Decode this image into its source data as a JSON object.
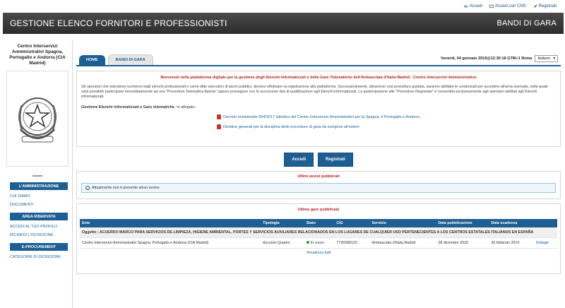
{
  "topbar": {
    "links": [
      {
        "label": "Accedi",
        "icon": "key-icon"
      },
      {
        "label": "Accedi con CNS",
        "icon": "card-icon"
      },
      {
        "label": "Registrati",
        "icon": "pencil-icon"
      }
    ]
  },
  "header": {
    "title": "GESTIONE ELENCO FORNITORI E PROFESSIONISTI",
    "right": "BANDI DI GARA"
  },
  "sidebar": {
    "org_name": "Centro Interservizi Amministrativi Spagna, Portogallo e Andorra (CIA Madrid)",
    "sections": [
      {
        "heading": "L'AMMINISTRAZIONE",
        "items": [
          "CHI SIAMO",
          "DOCUMENTI"
        ]
      },
      {
        "heading": "AREA RISERVATA",
        "items": [
          "ACCEDI AL TUO PROFILO",
          "RICHIEDI L'ISCRIZIONE"
        ]
      },
      {
        "heading": "E-PROCUREMENT",
        "items": [
          "CATEGORIE DI ISCRIZIONE"
        ]
      }
    ]
  },
  "tabs": [
    {
      "label": "HOME",
      "active": true
    },
    {
      "label": "BANDI DI GARA",
      "active": false
    }
  ],
  "datetime": "Venerdì, 04 gennaio 2019@12:30:18 GTM+1 Roma",
  "language": {
    "selected": "Italiano"
  },
  "welcome": {
    "title": "Benvenuti nella piattaforma digitale per la gestione degli Elenchi Informatizzati e delle Gare Telematiche dell'Ambasciata d'Italia Madrid - Centro Interservizi Amministrativo",
    "text": "Gli operatori che intendono iscriversi negli elenchi professionali o come ditte esecutrici di lavori pubblici, devono effettuare la registrazione alla piattaforma. Successivamente, attraverso una procedura guidata, saranno abilitate le credenziali per accedere all'area riservata, nella quale sarà possibile partecipare immediatamente ad una \"Procedura Telematica Aperta\" oppure proseguire con le successive fasi di qualificazione agli Elenchi informatizzati. La partecipazione alle \"Procedure Negoziate\" è consentita esclusivamente agli operatori abilitati agli Elenchi informatizzati.",
    "gestione_bold": "Gestione Elenchi informatizzati e Gare telematiche",
    "gestione_rest": ". In allegato:",
    "documents": [
      "Decreto ministeriale 504/2017 istitutivo del Centro Interservizi Amministrativi per la Spagna, il Portogallo e Andorra",
      "Direttive generali per la disciplina delle procedure di gara da svolgersi all'estero"
    ],
    "buttons": {
      "login": "Accedi",
      "register": "Registrati"
    }
  },
  "avvisi": {
    "title": "Ultimi avvisi pubblicati",
    "message": "Attualmente non è presente alcun avviso"
  },
  "gare": {
    "title": "Ultime gare pubblicate",
    "columns": [
      "Ente",
      "Tipologia",
      "Stato",
      "CIG",
      "Servizio",
      "Data pubblicazione",
      "Data scadenza",
      ""
    ],
    "oggetto": "Oggetto : ACUERDO MARCO PARA SERVICIOS DE LIMPIEZA, HIGIENE AMBIENTAL, PORTES Y SERVICIOS AUXILIARES RELACIONADOS EN LOS LUGARES DE CUALQUIER USO PERTENECIENTES A LOS CENTROS ESTATALES ITALIANOS EN ESPAÑA",
    "row": {
      "ente": "Centro Interservizi Amministrativi Spagna, Portogallo e Andorra (CIA Madrid)",
      "tipologia": "Accordo Quadro",
      "stato": "In corso",
      "cig": "772839812C",
      "servizio": "Ambasciata d'Italia Madrid",
      "pubblicazione": "28 dicembre 2018",
      "scadenza": "26 febbraio 2019",
      "details": "Dettagli"
    },
    "view_all": "Visualizza tutti"
  },
  "colors": {
    "brand": "#1d5f93",
    "header": "#333333",
    "alert_title": "#b32424",
    "status_ok": "#2e9b3e"
  }
}
